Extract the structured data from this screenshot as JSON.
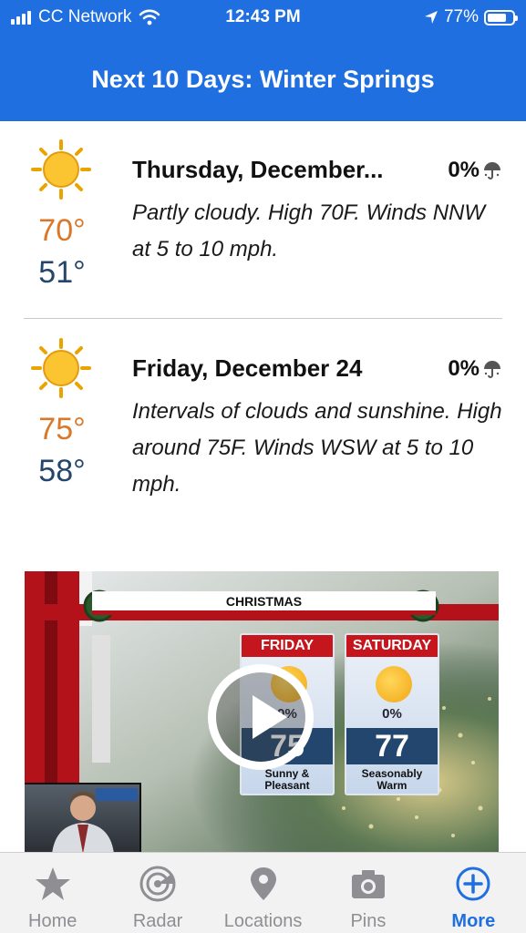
{
  "status_bar": {
    "carrier": "CC Network",
    "time": "12:43 PM",
    "battery": "77%",
    "battery_level": 0.77
  },
  "header": {
    "title": "Next 10 Days: Winter Springs"
  },
  "forecast": [
    {
      "day": "Thursday, December...",
      "high": "70°",
      "low": "51°",
      "precip": "0%",
      "description": "Partly cloudy. High 70F. Winds NNW at 5 to 10 mph.",
      "icon": "sun-icon"
    },
    {
      "day": "Friday, December 24",
      "high": "75°",
      "low": "58°",
      "precip": "0%",
      "description": "Intervals of clouds and sunshine. High around 75F. Winds WSW at 5 to 10 mph.",
      "icon": "sun-icon"
    }
  ],
  "video": {
    "banner": "CHRISTMAS",
    "cards": [
      {
        "day": "FRIDAY",
        "pct": "0%",
        "temp": "75",
        "cond": "Sunny &\nPleasant"
      },
      {
        "day": "SATURDAY",
        "pct": "0%",
        "temp": "77",
        "cond": "Seasonably\nWarm"
      }
    ]
  },
  "tabs": [
    {
      "label": "Home",
      "icon": "star-icon"
    },
    {
      "label": "Radar",
      "icon": "radar-icon"
    },
    {
      "label": "Locations",
      "icon": "location-pin-icon"
    },
    {
      "label": "Pins",
      "icon": "camera-icon"
    },
    {
      "label": "More",
      "icon": "plus-circle-icon",
      "active": true
    }
  ],
  "colors": {
    "header_blue": "#1f6fe0",
    "high_temp": "#d9782a",
    "low_temp": "#25466b",
    "tab_active": "#1f6fe0",
    "tab_inactive": "#8e8e93"
  }
}
